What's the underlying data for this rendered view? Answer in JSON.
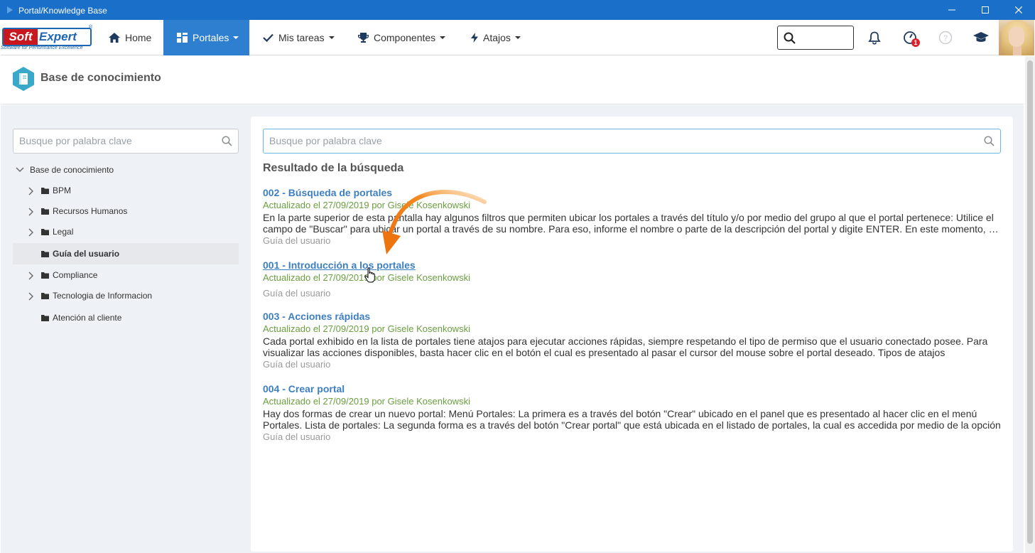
{
  "window": {
    "title": "Portal/Knowledge Base"
  },
  "logo": {
    "soft": "Soft",
    "expert": "Expert",
    "tagline": "Software for Performance Excellence"
  },
  "nav": {
    "home": "Home",
    "portales": "Portales",
    "tareas": "Mis tareas",
    "componentes": "Componentes",
    "atajos": "Atajos"
  },
  "notifications": {
    "tasks_badge": "1"
  },
  "header": {
    "title": "Base de conocimiento"
  },
  "sidebar": {
    "search_placeholder": "Busque por palabra clave",
    "root": "Base de conocimiento",
    "items": [
      {
        "label": "BPM",
        "expandable": true,
        "selected": false
      },
      {
        "label": "Recursos Humanos",
        "expandable": true,
        "selected": false
      },
      {
        "label": "Legal",
        "expandable": true,
        "selected": false
      },
      {
        "label": "Guía del usuario",
        "expandable": false,
        "selected": true
      },
      {
        "label": "Compliance",
        "expandable": true,
        "selected": false
      },
      {
        "label": "Tecnologia de Informacion",
        "expandable": true,
        "selected": false
      },
      {
        "label": "Atención al cliente",
        "expandable": false,
        "selected": false
      }
    ]
  },
  "main": {
    "search_placeholder": "Busque por palabra clave",
    "results_title": "Resultado de la búsqueda",
    "results": [
      {
        "title": "002 - Búsqueda de portales",
        "meta": "Actualizado el 27/09/2019 por Gisele Kosenkowski",
        "description": "En la parte superior de esta pantalla hay algunos filtros que permiten ubicar los portales a través del título y/o por medio del grupo al que el portal pertenece: Utilice el campo de \"Buscar\" para ubicar un portal a través de su nombre. Para eso, informe el nombre o parte de la descripción del portal y digite ENTER. En este momento, el sistema mostrará los portales",
        "category": "Guía del usuario"
      },
      {
        "title": "001 - Introducción a los portales",
        "meta": "Actualizado el 27/09/2019 por Gisele Kosenkowski",
        "description": "",
        "category": "Guía del usuario"
      },
      {
        "title": "003 - Acciones rápidas",
        "meta": "Actualizado el 27/09/2019 por Gisele Kosenkowski",
        "description": "Cada portal exhibido en la lista de portales tiene atajos para ejecutar acciones rápidas, siempre respetando el tipo de permiso que el usuario conectado posee. Para visualizar las acciones disponibles, basta hacer clic en el botón el cual es presentado al pasar el cursor del mouse sobre el portal deseado. Tipos de atajos",
        "category": "Guía del usuario"
      },
      {
        "title": "004 - Crear portal",
        "meta": "Actualizado el 27/09/2019 por Gisele Kosenkowski",
        "description": "Hay dos formas de crear un nuevo portal: Menú Portales: La primera es a través del botón \"Crear\" ubicado en el panel que es presentado al hacer clic en el menú Portales. Lista de portales: La segunda forma es a través del botón \"Crear portal\" que está ubicada en el listado de portales, la cual es accedida por medio de la opción",
        "category": "Guía del usuario"
      }
    ]
  },
  "colors": {
    "titlebar": "#1a6fc9",
    "nav_active": "#2f7fd0",
    "link": "#3d7fc1",
    "meta": "#6a9e3e",
    "annotation_arrow": "#f07d1a"
  }
}
